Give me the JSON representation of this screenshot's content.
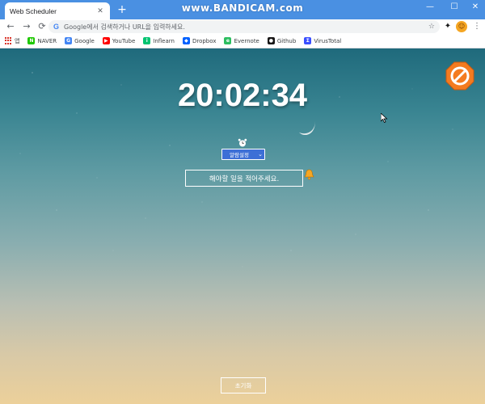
{
  "browser": {
    "tab_title": "Web Scheduler",
    "tab_close": "✕",
    "new_tab": "+",
    "watermark": "www.BANDICAM.com",
    "window_controls": {
      "minimize": "—",
      "maximize": "☐",
      "close": "✕"
    },
    "nav": {
      "back": "←",
      "forward": "→",
      "reload": "⟳"
    },
    "omnibox": {
      "g_icon": "G",
      "placeholder": "Google에서 검색하거나 URL을 입력하세요."
    },
    "extensions": {
      "puzzle": "✦",
      "face": "😐",
      "menu": "⋮"
    }
  },
  "bookmarks": {
    "apps_label": "앱",
    "items": [
      {
        "label": "NAVER",
        "icon": "naver-icon",
        "icon_glyph": "N",
        "color": "#1ec800"
      },
      {
        "label": "Google",
        "icon": "google-icon",
        "icon_glyph": "G",
        "color": "#4285f4"
      },
      {
        "label": "YouTube",
        "icon": "youtube-icon",
        "icon_glyph": "▶",
        "color": "#ff0000"
      },
      {
        "label": "Inflearn",
        "icon": "inflearn-icon",
        "icon_glyph": "i",
        "color": "#00c471"
      },
      {
        "label": "Dropbox",
        "icon": "dropbox-icon",
        "icon_glyph": "◆",
        "color": "#0061ff"
      },
      {
        "label": "Evernote",
        "icon": "evernote-icon",
        "icon_glyph": "e",
        "color": "#2dbe60"
      },
      {
        "label": "Github",
        "icon": "github-icon",
        "icon_glyph": "●",
        "color": "#181717"
      },
      {
        "label": "VirusTotal",
        "icon": "virustotal-icon",
        "icon_glyph": "Σ",
        "color": "#394eff"
      }
    ]
  },
  "page": {
    "clock": "20:02:34",
    "alarm_select": {
      "value": "알람설정",
      "chevron": "⌄"
    },
    "todo_placeholder": "해야할 일을 적어주세요.",
    "reset_label": "초기화"
  },
  "colors": {
    "tabstrip": "#4a90e2",
    "accent_select": "#3d6fd6",
    "sky_top": "#1f6a7c",
    "sky_bottom": "#ecd09a"
  }
}
